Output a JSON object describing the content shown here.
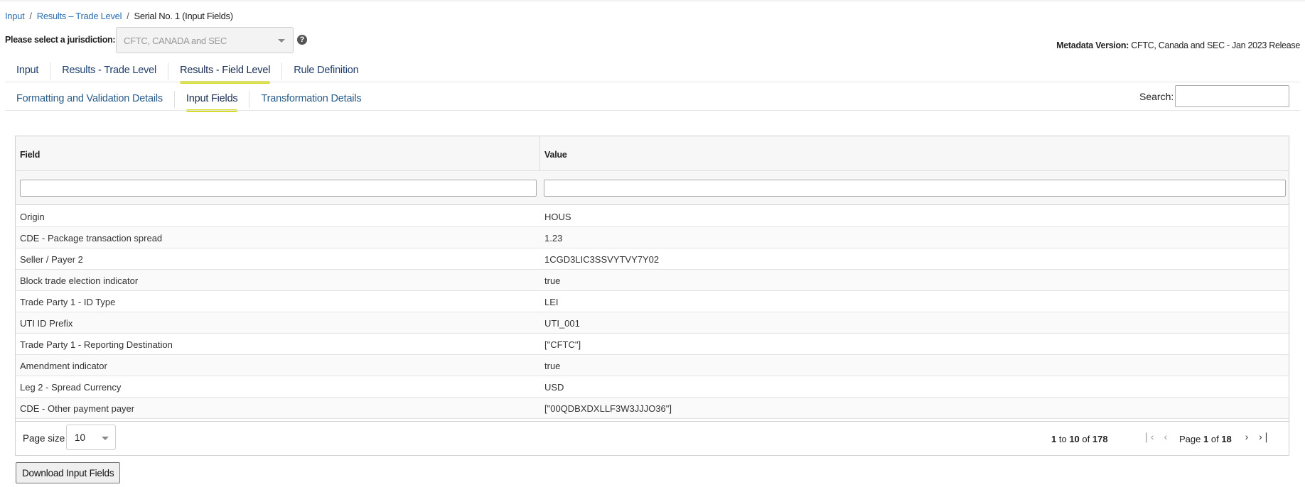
{
  "breadcrumb": {
    "items": [
      "Input",
      "Results – Trade Level"
    ],
    "separator": "/",
    "current": "Serial No. 1 (Input Fields)"
  },
  "jurisdiction": {
    "label": "Please select a jurisdiction:",
    "selected": "CFTC, CANADA and SEC",
    "help_icon": "question-circle-icon"
  },
  "metadata": {
    "label": "Metadata Version:",
    "value": "CFTC, Canada and SEC - Jan 2023 Release"
  },
  "tabs_primary": [
    {
      "label": "Input",
      "active": false
    },
    {
      "label": "Results - Trade Level",
      "active": false
    },
    {
      "label": "Results - Field Level",
      "active": true
    },
    {
      "label": "Rule Definition",
      "active": false
    }
  ],
  "tabs_secondary": [
    {
      "label": "Formatting and Validation Details",
      "active": false
    },
    {
      "label": "Input Fields",
      "active": true
    },
    {
      "label": "Transformation Details",
      "active": false
    }
  ],
  "search": {
    "label": "Search:",
    "value": ""
  },
  "grid": {
    "columns": [
      "Field",
      "Value"
    ],
    "rows": [
      [
        "Origin",
        "HOUS"
      ],
      [
        "CDE - Package transaction spread",
        "1.23"
      ],
      [
        "Seller / Payer 2",
        "1CGD3LIC3SSVYTVY7Y02"
      ],
      [
        "Block trade election indicator",
        "true"
      ],
      [
        "Trade Party 1 - ID Type",
        "LEI"
      ],
      [
        "UTI ID Prefix",
        "UTI_001"
      ],
      [
        "Trade Party 1 - Reporting Destination",
        "[\"CFTC\"]"
      ],
      [
        "Amendment indicator",
        "true"
      ],
      [
        "Leg 2 - Spread Currency",
        "USD"
      ],
      [
        "CDE - Other payment payer",
        "[\"00QDBXDXLLF3W3JJJO36\"]"
      ]
    ]
  },
  "pagination": {
    "page_size_label": "Page size",
    "page_size": "10",
    "from": "1",
    "to_word": "to",
    "to": "10",
    "of_word": "of",
    "total": "178",
    "page_word": "Page",
    "page": "1",
    "pages": "18"
  },
  "download_label": "Download Input Fields",
  "colors": {
    "accent_underline": "#d7dc2b",
    "link": "#2a6fb0"
  }
}
